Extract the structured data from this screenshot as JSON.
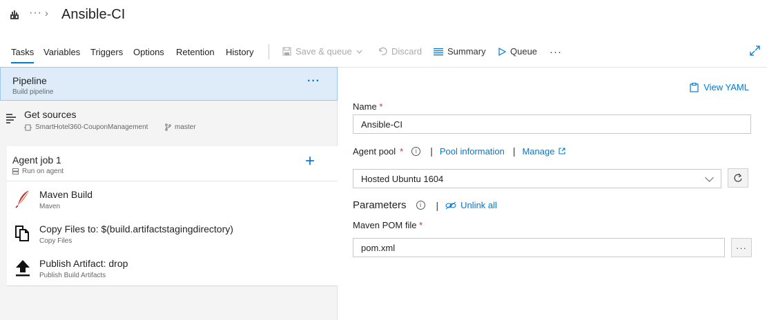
{
  "breadcrumb": {
    "more": "···",
    "chevron": "›",
    "title": "Ansible-CI"
  },
  "tabs": [
    {
      "label": "Tasks",
      "active": true
    },
    {
      "label": "Variables"
    },
    {
      "label": "Triggers"
    },
    {
      "label": "Options"
    },
    {
      "label": "Retention"
    },
    {
      "label": "History"
    }
  ],
  "toolbar": {
    "save_label": "Save & queue",
    "discard_label": "Discard",
    "summary_label": "Summary",
    "queue_label": "Queue",
    "more": "···"
  },
  "pipeline": {
    "title": "Pipeline",
    "subtitle": "Build pipeline",
    "more": "···"
  },
  "sources": {
    "title": "Get sources",
    "repo": "SmartHotel360-CouponManagement",
    "branch": "master"
  },
  "agent_job": {
    "title": "Agent job 1",
    "subtitle": "Run on agent",
    "add": "+"
  },
  "tasks": [
    {
      "title": "Maven Build",
      "subtitle": "Maven",
      "icon": "maven-feather-icon"
    },
    {
      "title": "Copy Files to: $(build.artifactstagingdirectory)",
      "subtitle": "Copy Files",
      "icon": "copy-files-icon"
    },
    {
      "title": "Publish Artifact: drop",
      "subtitle": "Publish Build Artifacts",
      "icon": "upload-arrow-icon"
    }
  ],
  "details": {
    "view_yaml": "View YAML",
    "name_label": "Name",
    "required_mark": "*",
    "name_value": "Ansible-CI",
    "agent_pool_label": "Agent pool",
    "pool_info_link": "Pool information",
    "manage_link": "Manage",
    "agent_pool_value": "Hosted Ubuntu 1604",
    "parameters_label": "Parameters",
    "unlink_all": "Unlink all",
    "pom_label": "Maven POM file",
    "pom_value": "pom.xml",
    "pom_more": "···",
    "separator": "|",
    "info_glyph": "i"
  },
  "colors": {
    "accent": "#0078d4",
    "selected_bg": "#deecf9",
    "panel_bg": "#f4f4f4",
    "required": "#c4314b"
  }
}
